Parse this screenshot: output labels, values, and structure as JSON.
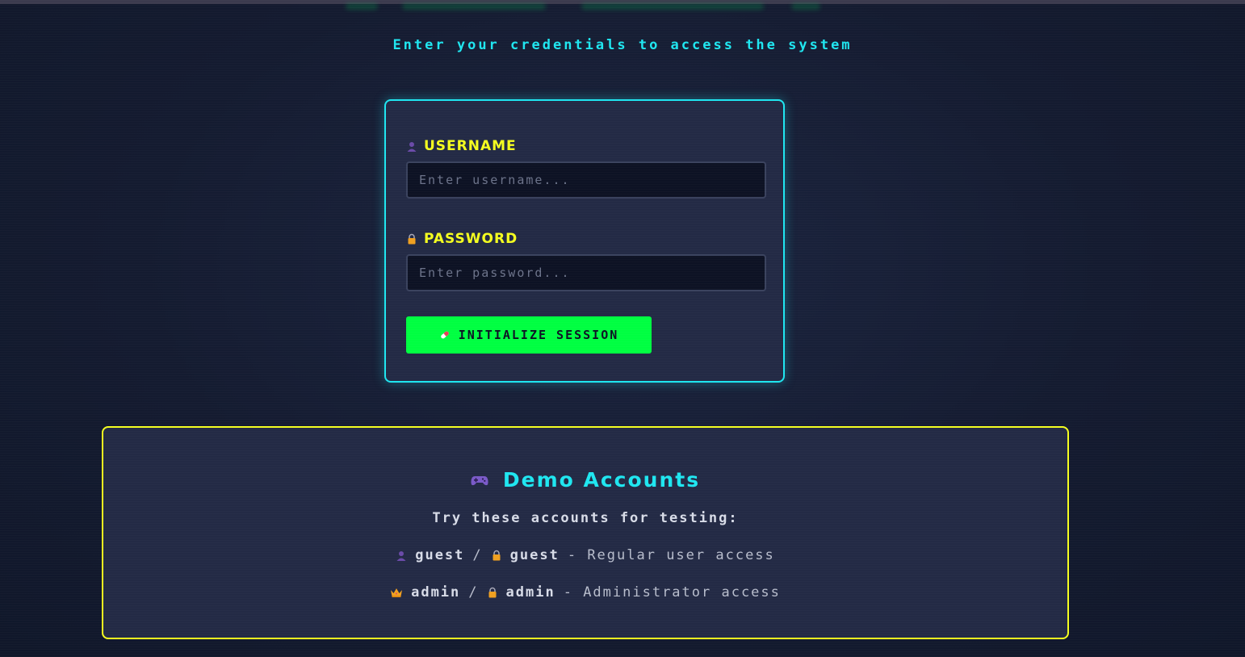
{
  "header": {
    "subtitle": "Enter your credentials to access the system"
  },
  "login": {
    "username": {
      "label": "USERNAME",
      "icon": "user-icon",
      "placeholder": "Enter username...",
      "value": ""
    },
    "password": {
      "label": "PASSWORD",
      "icon": "lock-icon",
      "placeholder": "Enter password...",
      "value": ""
    },
    "submit": {
      "label": "INITIALIZE SESSION",
      "icon": "pill-icon"
    }
  },
  "demo": {
    "title": "Demo Accounts",
    "title_icon": "gamepad-icon",
    "subtitle": "Try these accounts for testing:",
    "accounts": [
      {
        "user_icon": "user-icon",
        "username": "guest",
        "separator": "/",
        "pass_icon": "lock-icon",
        "password": "guest",
        "description": "- Regular user access"
      },
      {
        "user_icon": "crown-icon",
        "username": "admin",
        "separator": "/",
        "pass_icon": "lock-icon",
        "password": "admin",
        "description": "- Administrator access"
      }
    ]
  },
  "colors": {
    "background": "#141b30",
    "card": "#232a45",
    "cyan_accent": "#1fe6f0",
    "yellow_accent": "#f5ff1f",
    "green_button": "#00ff41",
    "input_bg": "#0d1224"
  }
}
